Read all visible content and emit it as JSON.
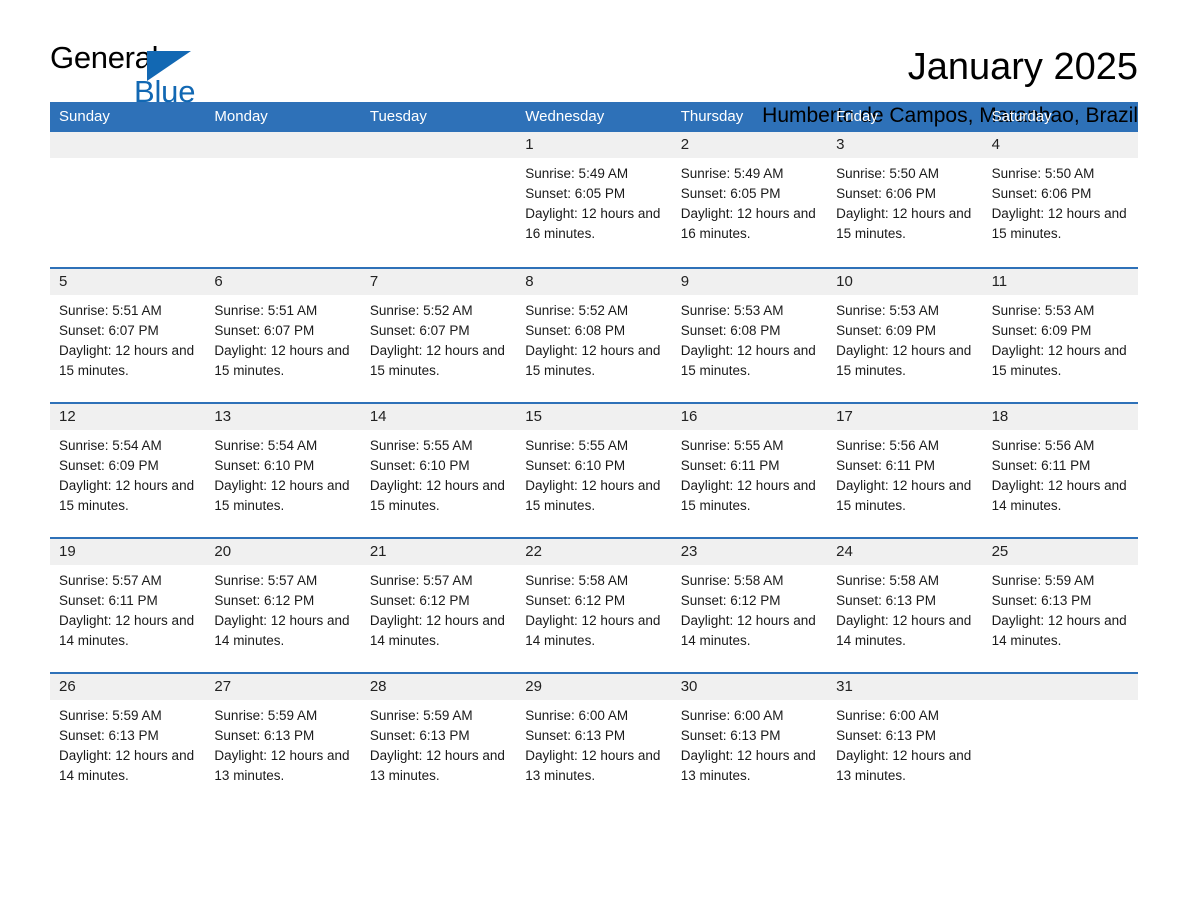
{
  "brand": {
    "name_part1": "General",
    "name_part2": "Blue",
    "accent_color": "#1268b3"
  },
  "header": {
    "title": "January 2025",
    "subtitle": "Humberto de Campos, Maranhao, Brazil"
  },
  "theme": {
    "header_blue": "#2e71b8",
    "daynum_band": "#f0f0f0"
  },
  "weekdays": [
    "Sunday",
    "Monday",
    "Tuesday",
    "Wednesday",
    "Thursday",
    "Friday",
    "Saturday"
  ],
  "weeks": [
    [
      {
        "day": "",
        "empty": true
      },
      {
        "day": "",
        "empty": true
      },
      {
        "day": "",
        "empty": true
      },
      {
        "day": "1",
        "sunrise": "Sunrise: 5:49 AM",
        "sunset": "Sunset: 6:05 PM",
        "daylight": "Daylight: 12 hours and 16 minutes."
      },
      {
        "day": "2",
        "sunrise": "Sunrise: 5:49 AM",
        "sunset": "Sunset: 6:05 PM",
        "daylight": "Daylight: 12 hours and 16 minutes."
      },
      {
        "day": "3",
        "sunrise": "Sunrise: 5:50 AM",
        "sunset": "Sunset: 6:06 PM",
        "daylight": "Daylight: 12 hours and 15 minutes."
      },
      {
        "day": "4",
        "sunrise": "Sunrise: 5:50 AM",
        "sunset": "Sunset: 6:06 PM",
        "daylight": "Daylight: 12 hours and 15 minutes."
      }
    ],
    [
      {
        "day": "5",
        "sunrise": "Sunrise: 5:51 AM",
        "sunset": "Sunset: 6:07 PM",
        "daylight": "Daylight: 12 hours and 15 minutes."
      },
      {
        "day": "6",
        "sunrise": "Sunrise: 5:51 AM",
        "sunset": "Sunset: 6:07 PM",
        "daylight": "Daylight: 12 hours and 15 minutes."
      },
      {
        "day": "7",
        "sunrise": "Sunrise: 5:52 AM",
        "sunset": "Sunset: 6:07 PM",
        "daylight": "Daylight: 12 hours and 15 minutes."
      },
      {
        "day": "8",
        "sunrise": "Sunrise: 5:52 AM",
        "sunset": "Sunset: 6:08 PM",
        "daylight": "Daylight: 12 hours and 15 minutes."
      },
      {
        "day": "9",
        "sunrise": "Sunrise: 5:53 AM",
        "sunset": "Sunset: 6:08 PM",
        "daylight": "Daylight: 12 hours and 15 minutes."
      },
      {
        "day": "10",
        "sunrise": "Sunrise: 5:53 AM",
        "sunset": "Sunset: 6:09 PM",
        "daylight": "Daylight: 12 hours and 15 minutes."
      },
      {
        "day": "11",
        "sunrise": "Sunrise: 5:53 AM",
        "sunset": "Sunset: 6:09 PM",
        "daylight": "Daylight: 12 hours and 15 minutes."
      }
    ],
    [
      {
        "day": "12",
        "sunrise": "Sunrise: 5:54 AM",
        "sunset": "Sunset: 6:09 PM",
        "daylight": "Daylight: 12 hours and 15 minutes."
      },
      {
        "day": "13",
        "sunrise": "Sunrise: 5:54 AM",
        "sunset": "Sunset: 6:10 PM",
        "daylight": "Daylight: 12 hours and 15 minutes."
      },
      {
        "day": "14",
        "sunrise": "Sunrise: 5:55 AM",
        "sunset": "Sunset: 6:10 PM",
        "daylight": "Daylight: 12 hours and 15 minutes."
      },
      {
        "day": "15",
        "sunrise": "Sunrise: 5:55 AM",
        "sunset": "Sunset: 6:10 PM",
        "daylight": "Daylight: 12 hours and 15 minutes."
      },
      {
        "day": "16",
        "sunrise": "Sunrise: 5:55 AM",
        "sunset": "Sunset: 6:11 PM",
        "daylight": "Daylight: 12 hours and 15 minutes."
      },
      {
        "day": "17",
        "sunrise": "Sunrise: 5:56 AM",
        "sunset": "Sunset: 6:11 PM",
        "daylight": "Daylight: 12 hours and 15 minutes."
      },
      {
        "day": "18",
        "sunrise": "Sunrise: 5:56 AM",
        "sunset": "Sunset: 6:11 PM",
        "daylight": "Daylight: 12 hours and 14 minutes."
      }
    ],
    [
      {
        "day": "19",
        "sunrise": "Sunrise: 5:57 AM",
        "sunset": "Sunset: 6:11 PM",
        "daylight": "Daylight: 12 hours and 14 minutes."
      },
      {
        "day": "20",
        "sunrise": "Sunrise: 5:57 AM",
        "sunset": "Sunset: 6:12 PM",
        "daylight": "Daylight: 12 hours and 14 minutes."
      },
      {
        "day": "21",
        "sunrise": "Sunrise: 5:57 AM",
        "sunset": "Sunset: 6:12 PM",
        "daylight": "Daylight: 12 hours and 14 minutes."
      },
      {
        "day": "22",
        "sunrise": "Sunrise: 5:58 AM",
        "sunset": "Sunset: 6:12 PM",
        "daylight": "Daylight: 12 hours and 14 minutes."
      },
      {
        "day": "23",
        "sunrise": "Sunrise: 5:58 AM",
        "sunset": "Sunset: 6:12 PM",
        "daylight": "Daylight: 12 hours and 14 minutes."
      },
      {
        "day": "24",
        "sunrise": "Sunrise: 5:58 AM",
        "sunset": "Sunset: 6:13 PM",
        "daylight": "Daylight: 12 hours and 14 minutes."
      },
      {
        "day": "25",
        "sunrise": "Sunrise: 5:59 AM",
        "sunset": "Sunset: 6:13 PM",
        "daylight": "Daylight: 12 hours and 14 minutes."
      }
    ],
    [
      {
        "day": "26",
        "sunrise": "Sunrise: 5:59 AM",
        "sunset": "Sunset: 6:13 PM",
        "daylight": "Daylight: 12 hours and 14 minutes."
      },
      {
        "day": "27",
        "sunrise": "Sunrise: 5:59 AM",
        "sunset": "Sunset: 6:13 PM",
        "daylight": "Daylight: 12 hours and 13 minutes."
      },
      {
        "day": "28",
        "sunrise": "Sunrise: 5:59 AM",
        "sunset": "Sunset: 6:13 PM",
        "daylight": "Daylight: 12 hours and 13 minutes."
      },
      {
        "day": "29",
        "sunrise": "Sunrise: 6:00 AM",
        "sunset": "Sunset: 6:13 PM",
        "daylight": "Daylight: 12 hours and 13 minutes."
      },
      {
        "day": "30",
        "sunrise": "Sunrise: 6:00 AM",
        "sunset": "Sunset: 6:13 PM",
        "daylight": "Daylight: 12 hours and 13 minutes."
      },
      {
        "day": "31",
        "sunrise": "Sunrise: 6:00 AM",
        "sunset": "Sunset: 6:13 PM",
        "daylight": "Daylight: 12 hours and 13 minutes."
      },
      {
        "day": "",
        "empty": true
      }
    ]
  ]
}
